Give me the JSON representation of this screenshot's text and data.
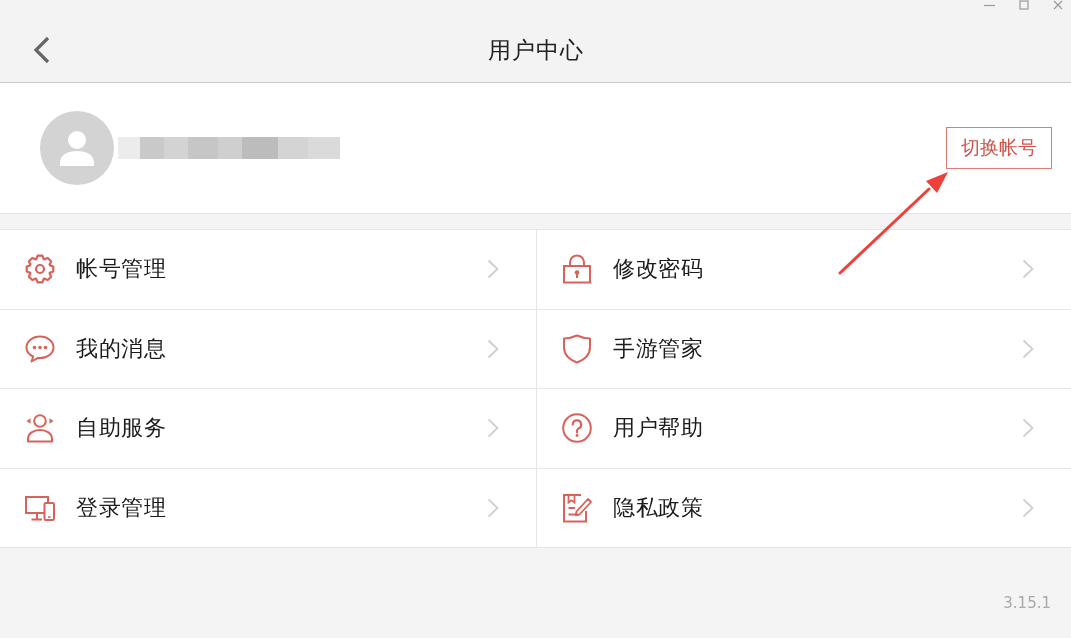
{
  "header": {
    "title": "用户中心"
  },
  "profile": {
    "switch_account_button": "切换帐号"
  },
  "menu": [
    {
      "label": "帐号管理"
    },
    {
      "label": "修改密码"
    },
    {
      "label": "我的消息"
    },
    {
      "label": "手游管家"
    },
    {
      "label": "自助服务"
    },
    {
      "label": "用户帮助"
    },
    {
      "label": "登录管理"
    },
    {
      "label": "隐私政策"
    }
  ],
  "footer": {
    "version": "3.15.1"
  }
}
